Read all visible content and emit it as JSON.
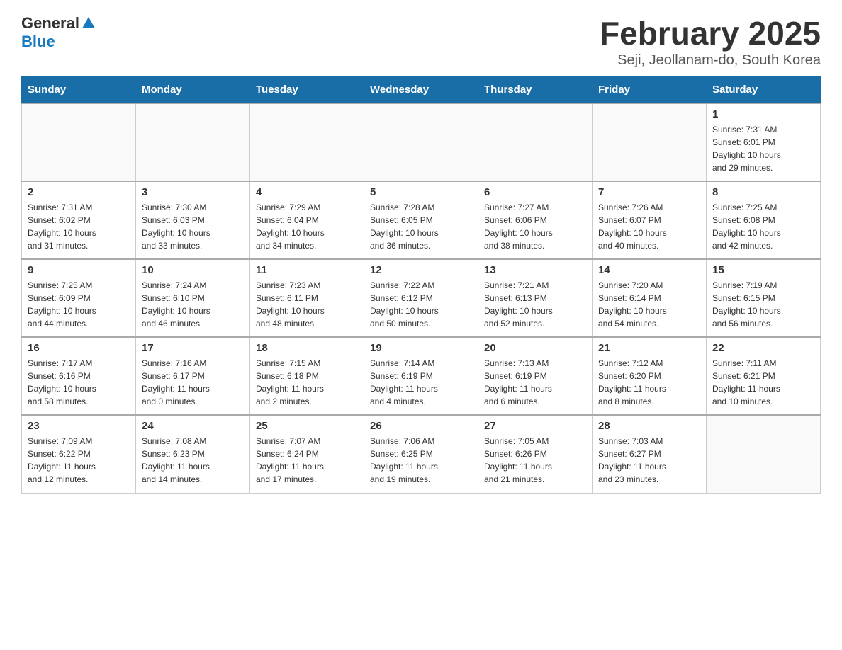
{
  "header": {
    "logo_general": "General",
    "logo_blue": "Blue",
    "title": "February 2025",
    "subtitle": "Seji, Jeollanam-do, South Korea"
  },
  "weekdays": [
    "Sunday",
    "Monday",
    "Tuesday",
    "Wednesday",
    "Thursday",
    "Friday",
    "Saturday"
  ],
  "weeks": [
    {
      "days": [
        {
          "num": "",
          "info": ""
        },
        {
          "num": "",
          "info": ""
        },
        {
          "num": "",
          "info": ""
        },
        {
          "num": "",
          "info": ""
        },
        {
          "num": "",
          "info": ""
        },
        {
          "num": "",
          "info": ""
        },
        {
          "num": "1",
          "info": "Sunrise: 7:31 AM\nSunset: 6:01 PM\nDaylight: 10 hours\nand 29 minutes."
        }
      ]
    },
    {
      "days": [
        {
          "num": "2",
          "info": "Sunrise: 7:31 AM\nSunset: 6:02 PM\nDaylight: 10 hours\nand 31 minutes."
        },
        {
          "num": "3",
          "info": "Sunrise: 7:30 AM\nSunset: 6:03 PM\nDaylight: 10 hours\nand 33 minutes."
        },
        {
          "num": "4",
          "info": "Sunrise: 7:29 AM\nSunset: 6:04 PM\nDaylight: 10 hours\nand 34 minutes."
        },
        {
          "num": "5",
          "info": "Sunrise: 7:28 AM\nSunset: 6:05 PM\nDaylight: 10 hours\nand 36 minutes."
        },
        {
          "num": "6",
          "info": "Sunrise: 7:27 AM\nSunset: 6:06 PM\nDaylight: 10 hours\nand 38 minutes."
        },
        {
          "num": "7",
          "info": "Sunrise: 7:26 AM\nSunset: 6:07 PM\nDaylight: 10 hours\nand 40 minutes."
        },
        {
          "num": "8",
          "info": "Sunrise: 7:25 AM\nSunset: 6:08 PM\nDaylight: 10 hours\nand 42 minutes."
        }
      ]
    },
    {
      "days": [
        {
          "num": "9",
          "info": "Sunrise: 7:25 AM\nSunset: 6:09 PM\nDaylight: 10 hours\nand 44 minutes."
        },
        {
          "num": "10",
          "info": "Sunrise: 7:24 AM\nSunset: 6:10 PM\nDaylight: 10 hours\nand 46 minutes."
        },
        {
          "num": "11",
          "info": "Sunrise: 7:23 AM\nSunset: 6:11 PM\nDaylight: 10 hours\nand 48 minutes."
        },
        {
          "num": "12",
          "info": "Sunrise: 7:22 AM\nSunset: 6:12 PM\nDaylight: 10 hours\nand 50 minutes."
        },
        {
          "num": "13",
          "info": "Sunrise: 7:21 AM\nSunset: 6:13 PM\nDaylight: 10 hours\nand 52 minutes."
        },
        {
          "num": "14",
          "info": "Sunrise: 7:20 AM\nSunset: 6:14 PM\nDaylight: 10 hours\nand 54 minutes."
        },
        {
          "num": "15",
          "info": "Sunrise: 7:19 AM\nSunset: 6:15 PM\nDaylight: 10 hours\nand 56 minutes."
        }
      ]
    },
    {
      "days": [
        {
          "num": "16",
          "info": "Sunrise: 7:17 AM\nSunset: 6:16 PM\nDaylight: 10 hours\nand 58 minutes."
        },
        {
          "num": "17",
          "info": "Sunrise: 7:16 AM\nSunset: 6:17 PM\nDaylight: 11 hours\nand 0 minutes."
        },
        {
          "num": "18",
          "info": "Sunrise: 7:15 AM\nSunset: 6:18 PM\nDaylight: 11 hours\nand 2 minutes."
        },
        {
          "num": "19",
          "info": "Sunrise: 7:14 AM\nSunset: 6:19 PM\nDaylight: 11 hours\nand 4 minutes."
        },
        {
          "num": "20",
          "info": "Sunrise: 7:13 AM\nSunset: 6:19 PM\nDaylight: 11 hours\nand 6 minutes."
        },
        {
          "num": "21",
          "info": "Sunrise: 7:12 AM\nSunset: 6:20 PM\nDaylight: 11 hours\nand 8 minutes."
        },
        {
          "num": "22",
          "info": "Sunrise: 7:11 AM\nSunset: 6:21 PM\nDaylight: 11 hours\nand 10 minutes."
        }
      ]
    },
    {
      "days": [
        {
          "num": "23",
          "info": "Sunrise: 7:09 AM\nSunset: 6:22 PM\nDaylight: 11 hours\nand 12 minutes."
        },
        {
          "num": "24",
          "info": "Sunrise: 7:08 AM\nSunset: 6:23 PM\nDaylight: 11 hours\nand 14 minutes."
        },
        {
          "num": "25",
          "info": "Sunrise: 7:07 AM\nSunset: 6:24 PM\nDaylight: 11 hours\nand 17 minutes."
        },
        {
          "num": "26",
          "info": "Sunrise: 7:06 AM\nSunset: 6:25 PM\nDaylight: 11 hours\nand 19 minutes."
        },
        {
          "num": "27",
          "info": "Sunrise: 7:05 AM\nSunset: 6:26 PM\nDaylight: 11 hours\nand 21 minutes."
        },
        {
          "num": "28",
          "info": "Sunrise: 7:03 AM\nSunset: 6:27 PM\nDaylight: 11 hours\nand 23 minutes."
        },
        {
          "num": "",
          "info": ""
        }
      ]
    }
  ]
}
